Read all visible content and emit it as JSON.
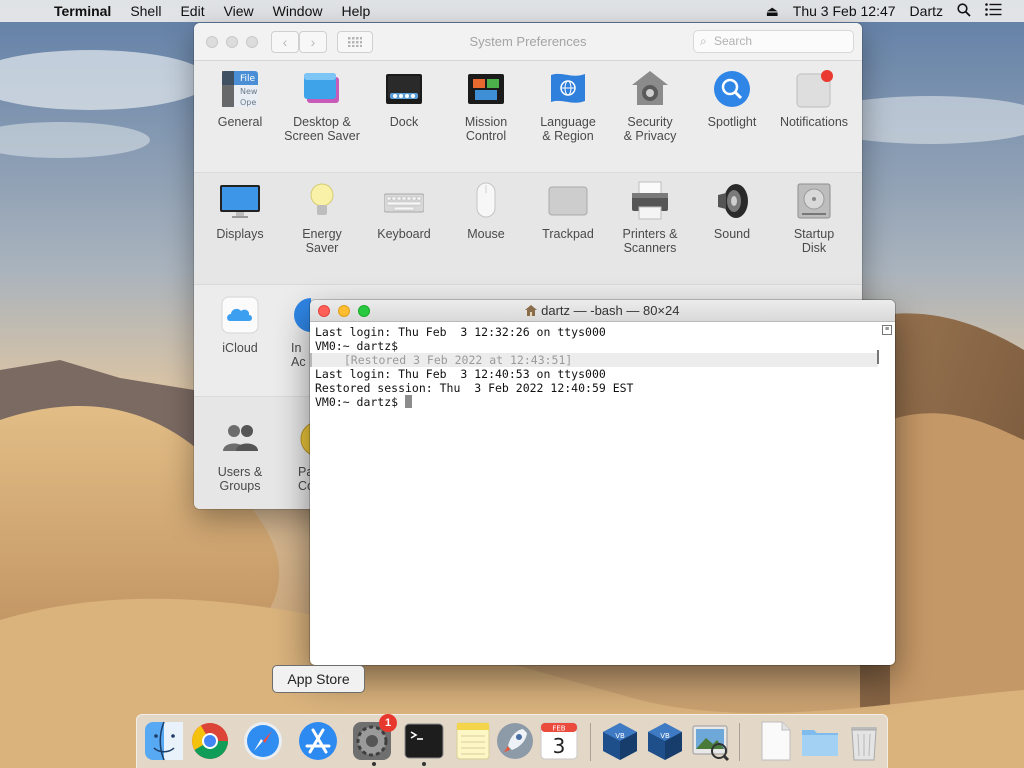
{
  "menubar": {
    "app_name": "Terminal",
    "items": [
      "Shell",
      "Edit",
      "View",
      "Window",
      "Help"
    ],
    "datetime": "Thu 3 Feb  12:47",
    "user": "Dartz"
  },
  "system_preferences": {
    "title": "System Preferences",
    "search_placeholder": "Search",
    "row1": [
      "General",
      "Desktop &\nScreen Saver",
      "Dock",
      "Mission\nControl",
      "Language\n& Region",
      "Security\n& Privacy",
      "Spotlight",
      "Notifications"
    ],
    "row2": [
      "Displays",
      "Energy\nSaver",
      "Keyboard",
      "Mouse",
      "Trackpad",
      "Printers &\nScanners",
      "Sound",
      "Startup\nDisk"
    ],
    "row3": [
      "iCloud",
      "In\nAc"
    ],
    "row4": [
      "Users &\nGroups",
      "Pa\nCo"
    ],
    "general_icon_text": [
      "File",
      "New",
      "Ope"
    ]
  },
  "terminal": {
    "title": "dartz — -bash — 80×24",
    "lines": [
      "Last login: Thu Feb  3 12:32:26 on ttys000",
      "VM0:~ dartz$",
      "  [Restored 3 Feb 2022 at 12:43:51]",
      "Last login: Thu Feb  3 12:40:53 on ttys000",
      "Restored session: Thu  3 Feb 2022 12:40:59 EST",
      "VM0:~ dartz$ "
    ]
  },
  "tooltip": {
    "text": "App Store"
  },
  "dock": {
    "system_prefs_badge": "1",
    "calendar_month": "FEB",
    "calendar_day": "3"
  },
  "colors": {
    "close": "#fe5f57",
    "minimize": "#febc2e",
    "zoom": "#28c840",
    "accent": "#2f7cf6"
  }
}
